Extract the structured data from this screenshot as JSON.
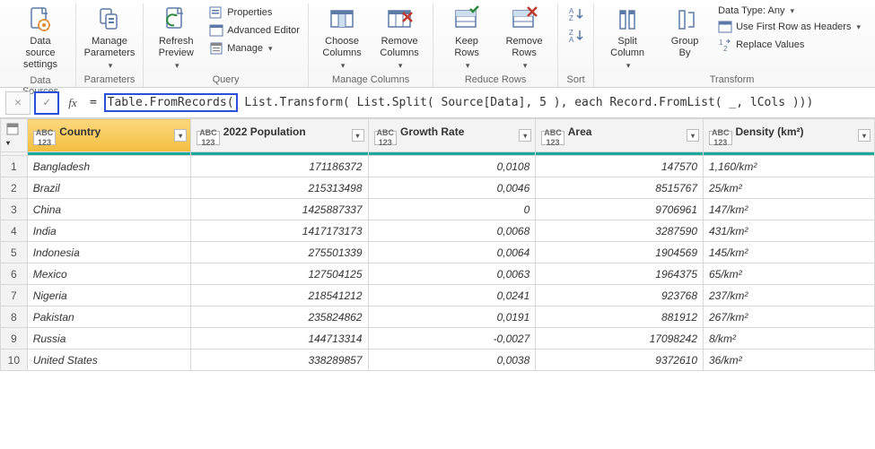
{
  "ribbon": {
    "groups": {
      "dataSources": {
        "label": "Data Sources",
        "settings": "Data source\nsettings"
      },
      "parameters": {
        "label": "Parameters",
        "manage": "Manage\nParameters"
      },
      "query": {
        "label": "Query",
        "refresh": "Refresh\nPreview",
        "properties": "Properties",
        "advanced": "Advanced Editor",
        "manage": "Manage"
      },
      "manageColumns": {
        "label": "Manage Columns",
        "choose": "Choose\nColumns",
        "remove": "Remove\nColumns"
      },
      "reduceRows": {
        "label": "Reduce Rows",
        "keep": "Keep\nRows",
        "remove": "Remove\nRows"
      },
      "sort": {
        "label": "Sort"
      },
      "transform": {
        "label": "Transform",
        "split": "Split\nColumn",
        "group": "Group\nBy",
        "dataType": "Data Type: Any",
        "firstRow": "Use First Row as Headers",
        "replace": "Replace Values"
      }
    }
  },
  "formula": {
    "fx": "fx",
    "eq": "= ",
    "p1": "Table.FromRecords(",
    "p2": " List.Transform( List.Split( Source[Data], 5 ), each Record.FromList( _, lCols )))"
  },
  "columns": [
    {
      "key": "country",
      "label": "Country"
    },
    {
      "key": "pop",
      "label": "2022 Population"
    },
    {
      "key": "growth",
      "label": "Growth Rate"
    },
    {
      "key": "area",
      "label": "Area"
    },
    {
      "key": "density",
      "label": "Density (km²)"
    }
  ],
  "typeBadge": {
    "top": "ABC",
    "bot": "123"
  },
  "rows": [
    {
      "n": "1",
      "country": "Bangladesh",
      "pop": "171186372",
      "growth": "0,0108",
      "area": "147570",
      "density": "1,160/km²"
    },
    {
      "n": "2",
      "country": "Brazil",
      "pop": "215313498",
      "growth": "0,0046",
      "area": "8515767",
      "density": "25/km²"
    },
    {
      "n": "3",
      "country": "China",
      "pop": "1425887337",
      "growth": "0",
      "area": "9706961",
      "density": "147/km²"
    },
    {
      "n": "4",
      "country": "India",
      "pop": "1417173173",
      "growth": "0,0068",
      "area": "3287590",
      "density": "431/km²"
    },
    {
      "n": "5",
      "country": "Indonesia",
      "pop": "275501339",
      "growth": "0,0064",
      "area": "1904569",
      "density": "145/km²"
    },
    {
      "n": "6",
      "country": "Mexico",
      "pop": "127504125",
      "growth": "0,0063",
      "area": "1964375",
      "density": "65/km²"
    },
    {
      "n": "7",
      "country": "Nigeria",
      "pop": "218541212",
      "growth": "0,0241",
      "area": "923768",
      "density": "237/km²"
    },
    {
      "n": "8",
      "country": "Pakistan",
      "pop": "235824862",
      "growth": "0,0191",
      "area": "881912",
      "density": "267/km²"
    },
    {
      "n": "9",
      "country": "Russia",
      "pop": "144713314",
      "growth": "-0,0027",
      "area": "17098242",
      "density": "8/km²"
    },
    {
      "n": "10",
      "country": "United States",
      "pop": "338289857",
      "growth": "0,0038",
      "area": "9372610",
      "density": "36/km²"
    }
  ]
}
